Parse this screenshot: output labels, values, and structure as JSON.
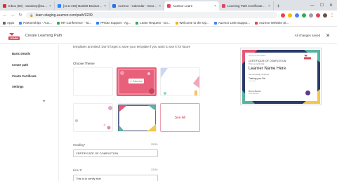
{
  "browser": {
    "tabs": [
      {
        "label": "Inbox (59) - sandeep@auzm...",
        "color": "#d93025",
        "active": false
      },
      {
        "label": "[ALS-226] Bartlett Brainard...",
        "color": "#2684ff",
        "active": false
      },
      {
        "label": "Auzmor - Calendar - Search...",
        "color": "#1a73e8",
        "active": false
      },
      {
        "label": "Auzmor Learn",
        "color": "#d9475a",
        "active": true
      },
      {
        "label": "Learning Path Certificates | ...",
        "color": "#d9475a",
        "active": false
      }
    ],
    "url": "learn-staging.auzmor.com/path/3239",
    "bookmarks": [
      {
        "label": "Apps",
        "color": "#5f6368"
      },
      {
        "label": "Partnerships - Auz...",
        "color": "#4285f4"
      },
      {
        "label": "HR Conference - Ta...",
        "color": "#34a853"
      },
      {
        "label": "PROD Support - Ag...",
        "color": "#2684ff"
      },
      {
        "label": "Learn Request - Go...",
        "color": "#34a853"
      },
      {
        "label": "Welcome to the Op...",
        "color": "#f4b400"
      },
      {
        "label": "Auzmor LMS Suppor...",
        "color": "#4285f4"
      },
      {
        "label": "Auzmor Website St...",
        "color": "#d9475a"
      }
    ]
  },
  "header": {
    "logo_text": "LEARN",
    "title": "Create Learning Path",
    "status": "All changes saved",
    "accent": "#d9475a"
  },
  "sidebar": {
    "items": [
      {
        "label": "Basic Details"
      },
      {
        "label": "Create path"
      },
      {
        "label": "Create Certificate"
      },
      {
        "label": "Settings"
      }
    ]
  },
  "main": {
    "intro": "templates provided. Don't forget to save your template if you want to use it for future",
    "choose_theme": "Choose Theme",
    "selected_label": "Selected",
    "see_all": "See All",
    "heading_label": "Heading*",
    "heading_count": "25/30",
    "heading_value": "CERTIFICATE OF COMPLETION",
    "line1_label": "Line 1*",
    "line1_count": "22/60",
    "line1_value": "This is to certify that"
  },
  "certificate": {
    "org": "Auzmor United States",
    "heading": "CERTIFICATE OF COMPLETION",
    "subline": "This is to certify that",
    "name": "Learner Name Here",
    "has_completed": "has successfully completed",
    "course": "Training your Pet",
    "course_id": "Course ID",
    "signer": "Bryce Becker",
    "signer_title": "Team Manager"
  }
}
